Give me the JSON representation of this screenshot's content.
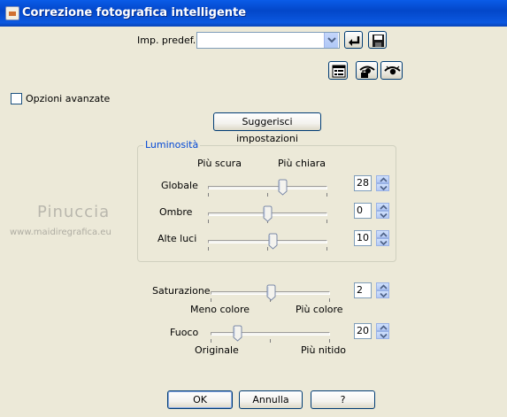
{
  "window": {
    "title": "Correzione fotografica intelligente"
  },
  "preset": {
    "label": "Imp. predef.:",
    "value": ""
  },
  "advanced": {
    "label": "Opzioni avanzate",
    "checked": false
  },
  "suggest_label": "Suggerisci impostazioni",
  "luminosity": {
    "legend": "Luminosità",
    "left_caption": "Più scura",
    "right_caption": "Più chiara",
    "rows": [
      {
        "label": "Globale",
        "value": "28"
      },
      {
        "label": "Ombre",
        "value": "0"
      },
      {
        "label": "Alte luci",
        "value": "10"
      }
    ]
  },
  "saturation": {
    "label": "Saturazione",
    "value": "2",
    "left_caption": "Meno colore",
    "right_caption": "Più colore"
  },
  "focus": {
    "label": "Fuoco",
    "value": "20",
    "left_caption": "Originale",
    "right_caption": "Più nitido"
  },
  "buttons": {
    "ok": "OK",
    "cancel": "Annulla",
    "help": "?"
  },
  "watermark": {
    "name": "Pinuccia",
    "url": "www.maidiregrafica.eu"
  },
  "icons": {
    "preset_arrow": "chevron-down-icon",
    "reset": "reset-arrow-icon",
    "save": "save-disk-icon",
    "randomize": "list-window-icon",
    "preview_lock": "eye-lock-icon",
    "preview": "eye-icon"
  },
  "colors": {
    "dialog_bg": "#ece9d8",
    "titlebar": "#0a5ce8",
    "accent": "#0046d5"
  }
}
